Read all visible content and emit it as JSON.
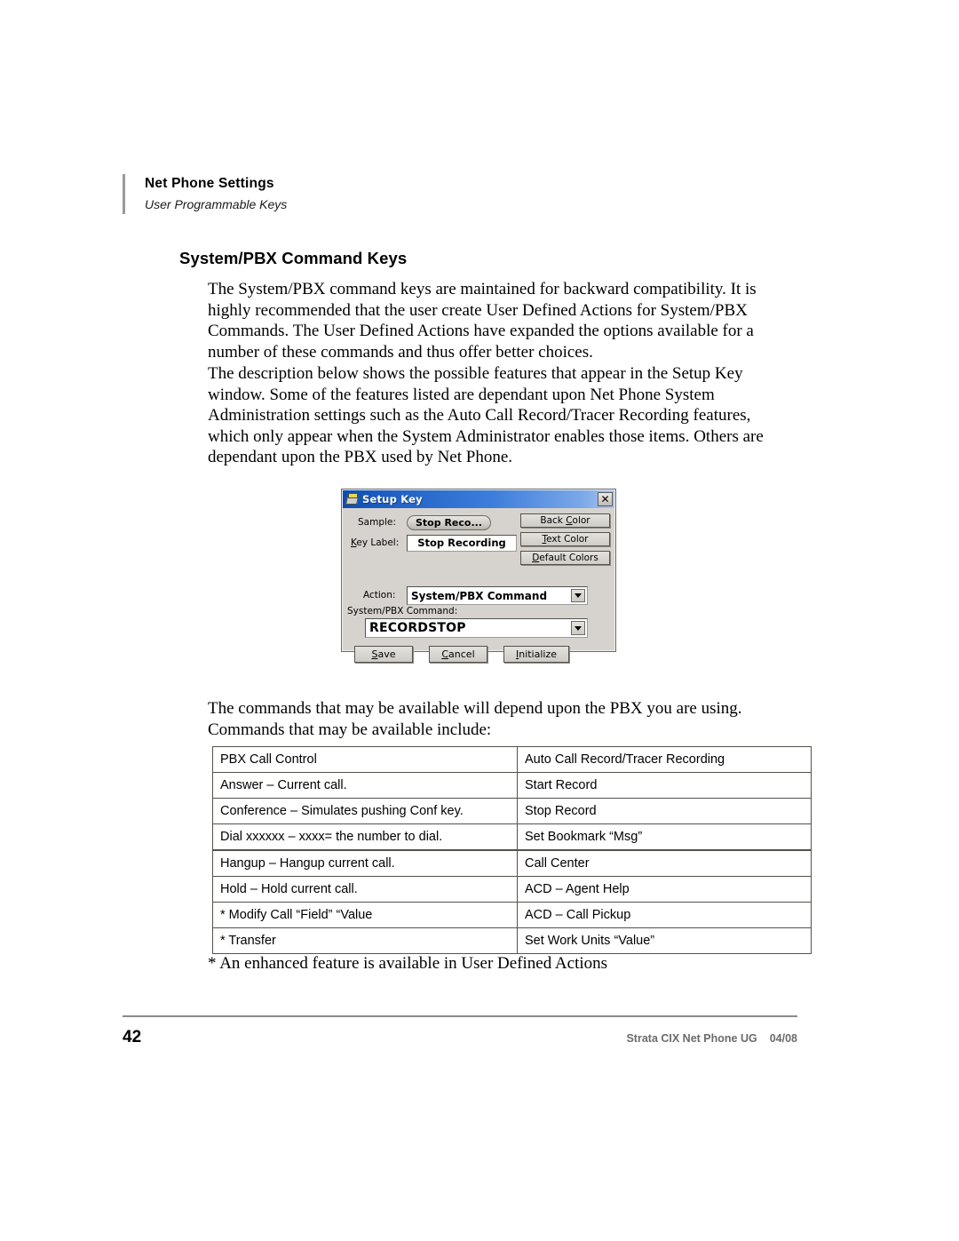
{
  "header": {
    "title": "Net Phone Settings",
    "subtitle": "User Programmable Keys"
  },
  "heading": "System/PBX Command Keys",
  "paragraphs": {
    "p1": "The System/PBX command keys are maintained for backward compatibility.  It is highly recommended that the user create User Defined Actions for System/PBX Commands.  The User Defined Actions have expanded the options available for a number of these commands and thus offer better choices.",
    "p2": "The description below shows the possible features that appear in the Setup Key window.  Some of the features listed are dependant upon Net Phone System Administration settings such as the Auto Call Record/Tracer Recording features, which only appear when the System Administrator enables those items.  Others are dependant upon the PBX used by Net Phone.",
    "p3": "The commands that may be available will depend upon the PBX you are using. Commands that may be available include:",
    "footnote": "* An enhanced feature is available in User Defined Actions"
  },
  "dialog": {
    "title": "Setup Key",
    "icon": "setup-key-icon",
    "close_label": "✕",
    "sample_label": "Sample:",
    "sample_value": "Stop Reco...",
    "key_label_label": "Key Label:",
    "key_label_value": "Stop Recording",
    "back_color_button": "Back Color",
    "text_color_button": "Text Color",
    "default_colors_button": "Default Colors",
    "action_label": "Action:",
    "action_value": "System/PBX Command",
    "command_label": "System/PBX Command:",
    "command_value": "RECORDSTOP",
    "save_button": "Save",
    "cancel_button": "Cancel",
    "initialize_button": "Initialize",
    "titlebar_color": "#1f5fc4",
    "face_color": "#d6d3ce"
  },
  "table": {
    "rows": [
      {
        "left": "PBX Call Control",
        "right": "Auto Call Record/Tracer Recording",
        "indent_left": false,
        "indent_right": false,
        "thick": false
      },
      {
        "left": "Answer – Current call.",
        "right": "Start Record",
        "indent_left": true,
        "indent_right": true,
        "thick": false
      },
      {
        "left": "Conference – Simulates pushing Conf key.",
        "right": "Stop Record",
        "indent_left": true,
        "indent_right": true,
        "thick": false
      },
      {
        "left": "Dial xxxxxx – xxxx= the number to dial.",
        "right": "Set Bookmark “Msg”",
        "indent_left": true,
        "indent_right": true,
        "thick": false
      },
      {
        "left": "Hangup – Hangup current call.",
        "right": "Call Center",
        "indent_left": true,
        "indent_right": false,
        "thick": true
      },
      {
        "left": "Hold – Hold current call.",
        "right": "ACD – Agent Help",
        "indent_left": true,
        "indent_right": true,
        "thick": false
      },
      {
        "left": "* Modify Call “Field” “Value",
        "right": "ACD – Call Pickup",
        "indent_left": false,
        "indent_right": true,
        "thick": false
      },
      {
        "left": "* Transfer",
        "right": "Set Work Units “Value”",
        "indent_left": false,
        "indent_right": true,
        "thick": false
      }
    ]
  },
  "footer": {
    "page_number": "42",
    "document": "Strata CIX Net Phone UG",
    "date": "04/08"
  }
}
